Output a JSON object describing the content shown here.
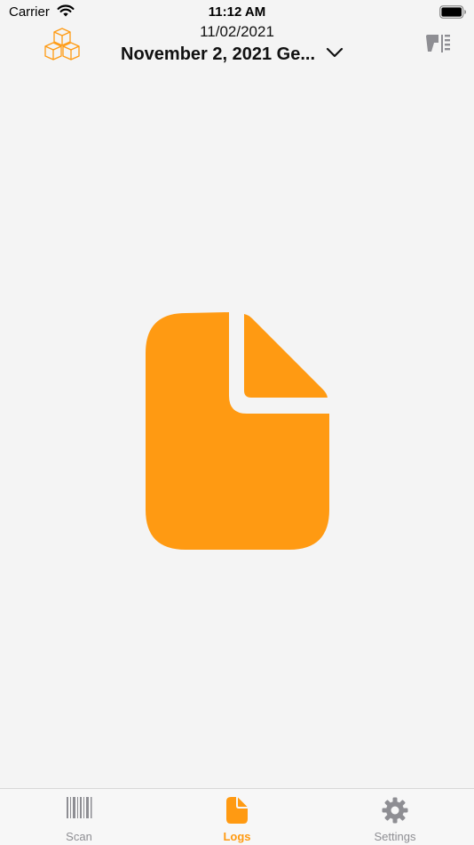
{
  "status_bar": {
    "carrier": "Carrier",
    "time": "11:12 AM",
    "icons": [
      "wifi-icon",
      "battery-icon"
    ]
  },
  "nav": {
    "date": "11/02/2021",
    "title": "November 2, 2021 Ge...",
    "left_icon": "boxes-icon",
    "right_icon": "barcode-scanner-icon",
    "title_icon": "chevron-down-icon"
  },
  "content": {
    "icon": "document-icon"
  },
  "tabs": [
    {
      "label": "Scan",
      "icon": "barcode-icon",
      "active": false
    },
    {
      "label": "Logs",
      "icon": "document-icon",
      "active": true
    },
    {
      "label": "Settings",
      "icon": "gear-icon",
      "active": false
    }
  ],
  "colors": {
    "accent": "#ff9a12",
    "background": "#f4f4f4",
    "inactive": "#8e8e93"
  }
}
